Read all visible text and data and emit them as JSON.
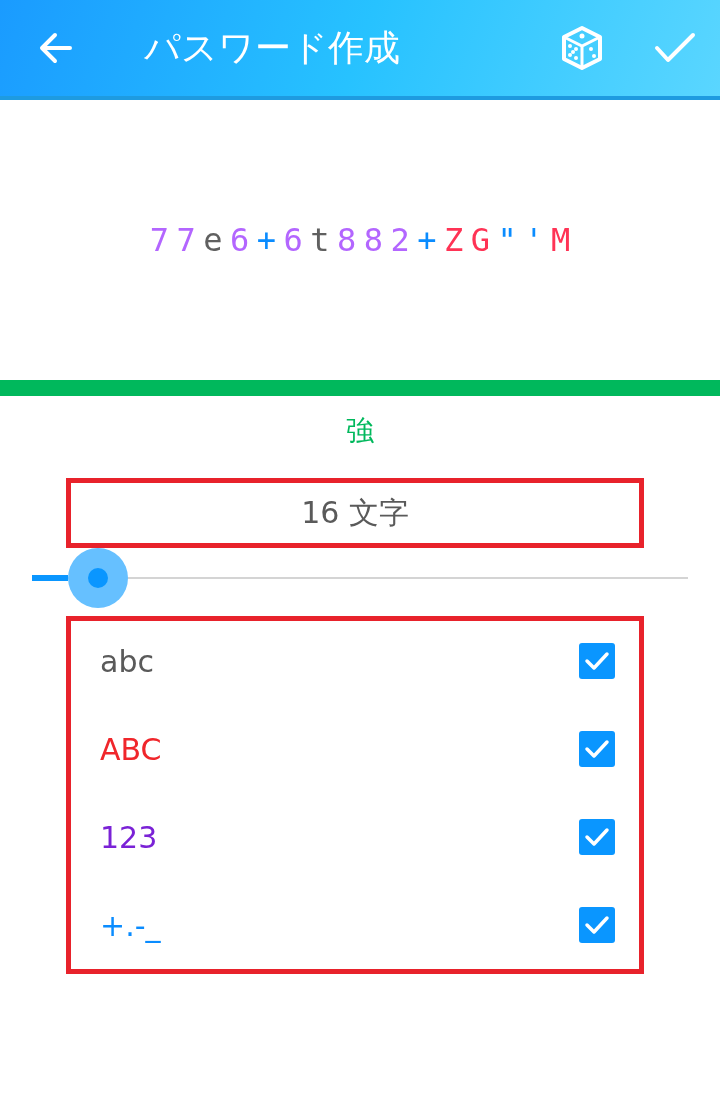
{
  "app_bar": {
    "title": "パスワード作成"
  },
  "password": [
    {
      "char": "7",
      "kind": "digit"
    },
    {
      "char": "7",
      "kind": "digit"
    },
    {
      "char": "e",
      "kind": "lower"
    },
    {
      "char": "6",
      "kind": "digit"
    },
    {
      "char": "+",
      "kind": "symbol"
    },
    {
      "char": "6",
      "kind": "digit"
    },
    {
      "char": "t",
      "kind": "lower"
    },
    {
      "char": "8",
      "kind": "digit"
    },
    {
      "char": "8",
      "kind": "digit"
    },
    {
      "char": "2",
      "kind": "digit"
    },
    {
      "char": "+",
      "kind": "symbol"
    },
    {
      "char": "Z",
      "kind": "upper"
    },
    {
      "char": "G",
      "kind": "upper"
    },
    {
      "char": "\"",
      "kind": "symbol"
    },
    {
      "char": "'",
      "kind": "symbol"
    },
    {
      "char": "M",
      "kind": "upper"
    }
  ],
  "strength": {
    "level": 1,
    "label": "強",
    "color": "#00b85c"
  },
  "length": {
    "label": "16 文字"
  },
  "length_slider": {
    "level": 0.1
  },
  "options": [
    {
      "label": "abc",
      "kind": "lower",
      "checked": true
    },
    {
      "label": "ABC",
      "kind": "upper",
      "checked": true
    },
    {
      "label": "123",
      "kind": "digit",
      "checked": true
    },
    {
      "label": "+.-_",
      "kind": "symbol",
      "checked": true
    }
  ]
}
